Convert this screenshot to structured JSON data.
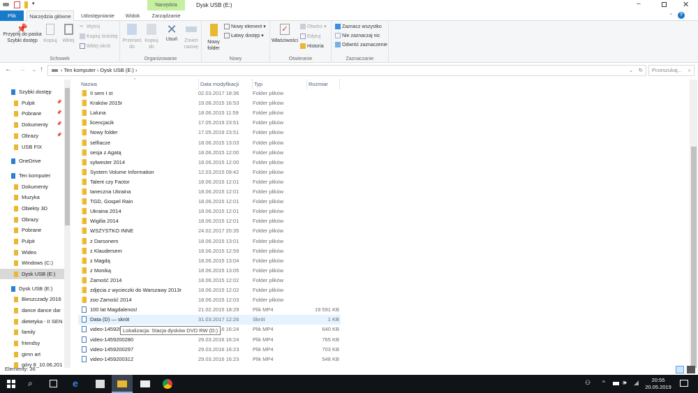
{
  "window": {
    "title": "Dysk USB (E:)",
    "context_tab": "Narzędzia dysków"
  },
  "tabs": [
    "Plik",
    "Narzędzia główne",
    "Udostępnianie",
    "Widok",
    "Zarządzanie"
  ],
  "ribbon": {
    "schowek": {
      "label": "Schowek",
      "pin": "Przypnij do paska Szybki dostęp",
      "copy": "Kopiuj",
      "paste": "Wklej",
      "cut": "Wytnij",
      "copy_path": "Kopiuj ścieżkę",
      "paste_shortcut": "Wklej skrót"
    },
    "organizowanie": {
      "label": "Organizowanie",
      "move": "Przenieś do",
      "copy_to": "Kopiuj do",
      "delete": "Usuń",
      "rename": "Zmień nazwę"
    },
    "nowy": {
      "label": "Nowy",
      "new_folder": "Nowy folder",
      "new_item": "Nowy element",
      "easy_access": "Łatwy dostęp"
    },
    "otwieranie": {
      "label": "Otwieranie",
      "properties": "Właściwości",
      "open": "Otwórz",
      "edit": "Edytuj",
      "history": "Historia"
    },
    "zaznaczanie": {
      "label": "Zaznaczanie",
      "select_all": "Zaznacz wszystko",
      "select_none": "Nie zaznaczaj nic",
      "invert": "Odwróć zaznaczenie"
    }
  },
  "address": {
    "crumbs": [
      "Ten komputer",
      "Dysk USB (E:)"
    ],
    "search_placeholder": "Przeszukaj..."
  },
  "sidebar": [
    {
      "label": "Szybki dostęp",
      "level": 0,
      "pin": false
    },
    {
      "label": "Pulpit",
      "level": 1,
      "pin": true
    },
    {
      "label": "Pobrane",
      "level": 1,
      "pin": true
    },
    {
      "label": "Dokumenty",
      "level": 1,
      "pin": true
    },
    {
      "label": "Obrazy",
      "level": 1,
      "pin": true
    },
    {
      "label": "USB FIX",
      "level": 1,
      "pin": false
    },
    {
      "label": "OneDrive",
      "level": 0,
      "pin": false
    },
    {
      "label": "Ten komputer",
      "level": 0,
      "pin": false
    },
    {
      "label": "Dokumenty",
      "level": 1
    },
    {
      "label": "Muzyka",
      "level": 1
    },
    {
      "label": "Obiekty 3D",
      "level": 1
    },
    {
      "label": "Obrazy",
      "level": 1
    },
    {
      "label": "Pobrane",
      "level": 1
    },
    {
      "label": "Pulpit",
      "level": 1
    },
    {
      "label": "Wideo",
      "level": 1
    },
    {
      "label": "Windows (C:)",
      "level": 1
    },
    {
      "label": "Dysk USB (E:)",
      "level": 1,
      "selected": true
    },
    {
      "label": "Dysk USB (E:)",
      "level": 0
    },
    {
      "label": "Bieszczady 2016",
      "level": 1
    },
    {
      "label": "dance dance dar",
      "level": 1
    },
    {
      "label": "dietetyka - II SEN",
      "level": 1
    },
    {
      "label": "family",
      "level": 1
    },
    {
      "label": "friendsy",
      "level": 1
    },
    {
      "label": "gimn art",
      "level": 1
    },
    {
      "label": "góry 8_10.06.201",
      "level": 1
    }
  ],
  "columns": [
    "Nazwa",
    "Data modyfikacji",
    "Typ",
    "Rozmiar"
  ],
  "files": [
    {
      "name": "II sem I st",
      "date": "02.03.2017 18:36",
      "type": "Folder plików",
      "size": "",
      "kind": "folder"
    },
    {
      "name": "Kraków 2015r",
      "date": "19.08.2015 16:53",
      "type": "Folder plików",
      "size": "",
      "kind": "folder"
    },
    {
      "name": "Laluna",
      "date": "18.06.2015 11:59",
      "type": "Folder plików",
      "size": "",
      "kind": "folder"
    },
    {
      "name": "licencjacik",
      "date": "17.05.2019 23:51",
      "type": "Folder plików",
      "size": "",
      "kind": "folder"
    },
    {
      "name": "Nowy folder",
      "date": "17.05.2019 23:51",
      "type": "Folder plików",
      "size": "",
      "kind": "folder"
    },
    {
      "name": "selfiacze",
      "date": "18.06.2015 13:03",
      "type": "Folder plików",
      "size": "",
      "kind": "folder"
    },
    {
      "name": "sesja z Agatą",
      "date": "18.06.2015 12:00",
      "type": "Folder plików",
      "size": "",
      "kind": "folder"
    },
    {
      "name": "sylwester 2014",
      "date": "18.06.2015 12:00",
      "type": "Folder plików",
      "size": "",
      "kind": "folder"
    },
    {
      "name": "System Volume Information",
      "date": "12.03.2015 09:42",
      "type": "Folder plików",
      "size": "",
      "kind": "folder"
    },
    {
      "name": "Talent czy Factor",
      "date": "18.06.2015 12:01",
      "type": "Folder plików",
      "size": "",
      "kind": "folder"
    },
    {
      "name": "taneczna Ukraina",
      "date": "18.06.2015 12:01",
      "type": "Folder plików",
      "size": "",
      "kind": "folder"
    },
    {
      "name": "TGD, Gospel Rain",
      "date": "18.06.2015 12:01",
      "type": "Folder plików",
      "size": "",
      "kind": "folder"
    },
    {
      "name": "Ukraina 2014",
      "date": "18.06.2015 12:01",
      "type": "Folder plików",
      "size": "",
      "kind": "folder"
    },
    {
      "name": "Wigilia 2014",
      "date": "18.06.2015 12:01",
      "type": "Folder plików",
      "size": "",
      "kind": "folder"
    },
    {
      "name": "WSZYSTKO INNE",
      "date": "24.02.2017 20:35",
      "type": "Folder plików",
      "size": "",
      "kind": "folder"
    },
    {
      "name": "z Darsonem",
      "date": "18.06.2015 13:01",
      "type": "Folder plików",
      "size": "",
      "kind": "folder"
    },
    {
      "name": "z Klaudersem",
      "date": "18.06.2015 12:59",
      "type": "Folder plików",
      "size": "",
      "kind": "folder"
    },
    {
      "name": "z Magdą",
      "date": "18.06.2015 13:04",
      "type": "Folder plików",
      "size": "",
      "kind": "folder"
    },
    {
      "name": "z Moniką",
      "date": "18.06.2015 13:05",
      "type": "Folder plików",
      "size": "",
      "kind": "folder"
    },
    {
      "name": "Zamość 2014",
      "date": "18.06.2015 12:02",
      "type": "Folder plików",
      "size": "",
      "kind": "folder"
    },
    {
      "name": "zdjęcia z wycieczki do Warszawy 2013r",
      "date": "18.06.2015 12:02",
      "type": "Folder plików",
      "size": "",
      "kind": "folder"
    },
    {
      "name": "zoo Zamość 2014",
      "date": "18.06.2015 12:03",
      "type": "Folder plików",
      "size": "",
      "kind": "folder"
    },
    {
      "name": "100 lat Magdalenos!",
      "date": "21.02.2015 18:29",
      "type": "Plik MP4",
      "size": "19 591 KB",
      "kind": "file"
    },
    {
      "name": "Data (D) — skrót",
      "date": "31.03.2017 12:26",
      "type": "Skrót",
      "size": "1 KB",
      "kind": "shortcut",
      "hover": true
    },
    {
      "name": "video-1459200",
      "date": "29.03.2016 16:24",
      "type": "Plik MP4",
      "size": "640 KB",
      "kind": "file"
    },
    {
      "name": "video-1459200280",
      "date": "29.03.2016 16:24",
      "type": "Plik MP4",
      "size": "765 KB",
      "kind": "file"
    },
    {
      "name": "video-1459200297",
      "date": "29.03.2016 16:23",
      "type": "Plik MP4",
      "size": "703 KB",
      "kind": "file"
    },
    {
      "name": "video-1459200312",
      "date": "29.03.2016 16:23",
      "type": "Plik MP4",
      "size": "548 KB",
      "kind": "file"
    }
  ],
  "tooltip": "Lokalizacja: Stacja dysków DVD RW (D:)",
  "status": "Elementy: 36",
  "tray": {
    "time": "20:55",
    "date": "20.05.2019"
  },
  "colors": {
    "accent": "#1979ca",
    "context_tab": "#c4f0a0",
    "hover_row": "#e5f3ff",
    "taskbar": "#101318"
  }
}
